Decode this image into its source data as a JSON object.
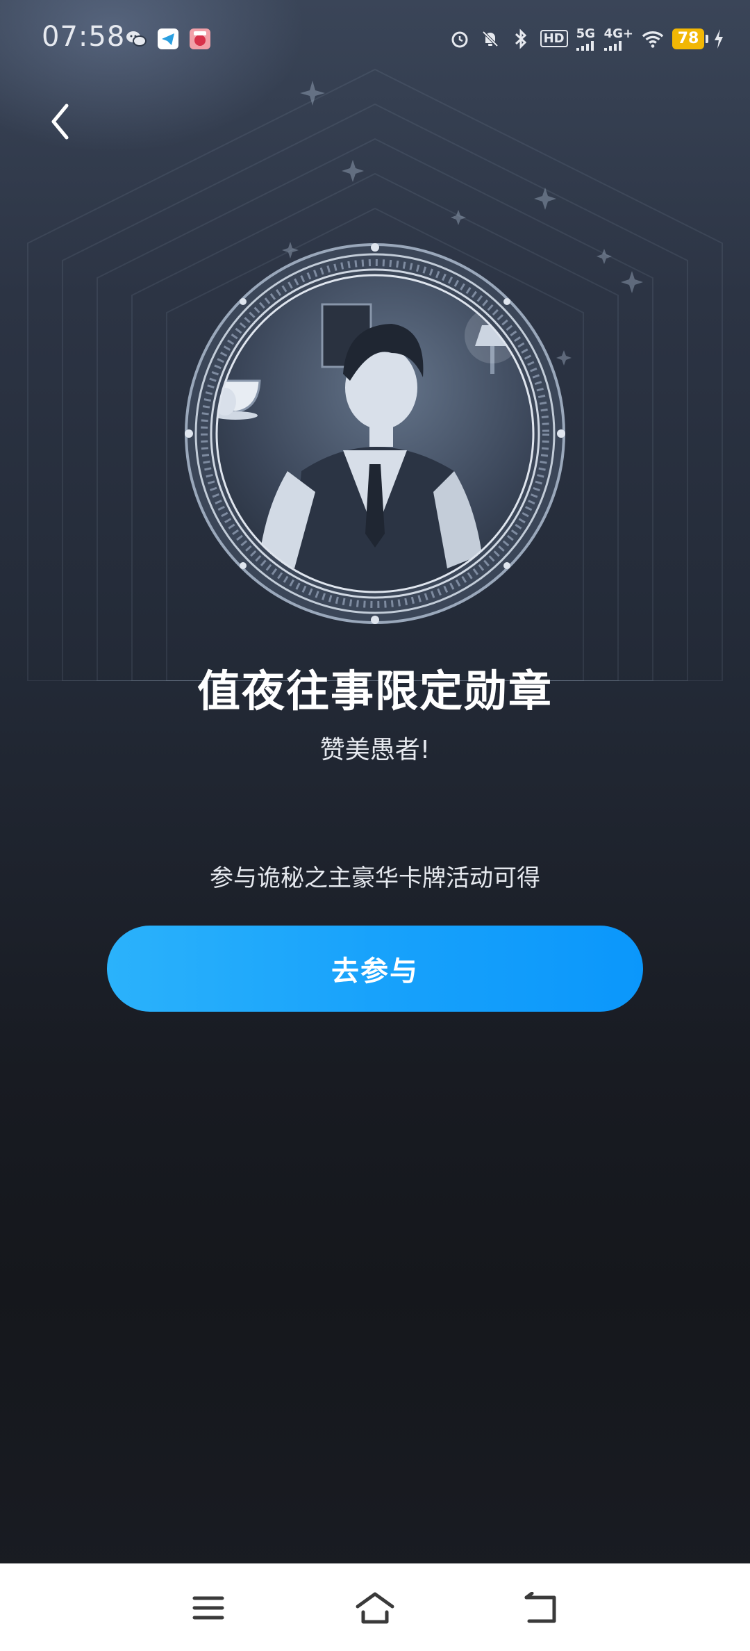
{
  "status_bar": {
    "time": "07:58",
    "left_icons": [
      "wechat-icon",
      "telegram-icon",
      "game-app-icon"
    ],
    "right_icons": [
      "alarm-icon",
      "mute-icon",
      "bluetooth-icon",
      "hd-icon",
      "signal-5g-icon",
      "signal-4g-icon",
      "wifi-icon",
      "battery-icon",
      "charging-icon"
    ],
    "hd_label": "HD",
    "net1": "5G",
    "net2": "4G+",
    "battery": "78"
  },
  "header": {
    "back_icon": "chevron-left-icon"
  },
  "badge": {
    "title": "值夜往事限定勋章",
    "subtitle": "赞美愚者!",
    "condition": "参与诡秘之主豪华卡牌活动可得",
    "button_label": "去参与"
  },
  "nav_bar": {
    "icons": [
      "menu-icon",
      "home-icon",
      "back-icon"
    ]
  },
  "colors": {
    "accent": "#1aa3fb",
    "background_top": "#3a4558",
    "background_bottom": "#15171c",
    "battery": "#f2b705"
  }
}
